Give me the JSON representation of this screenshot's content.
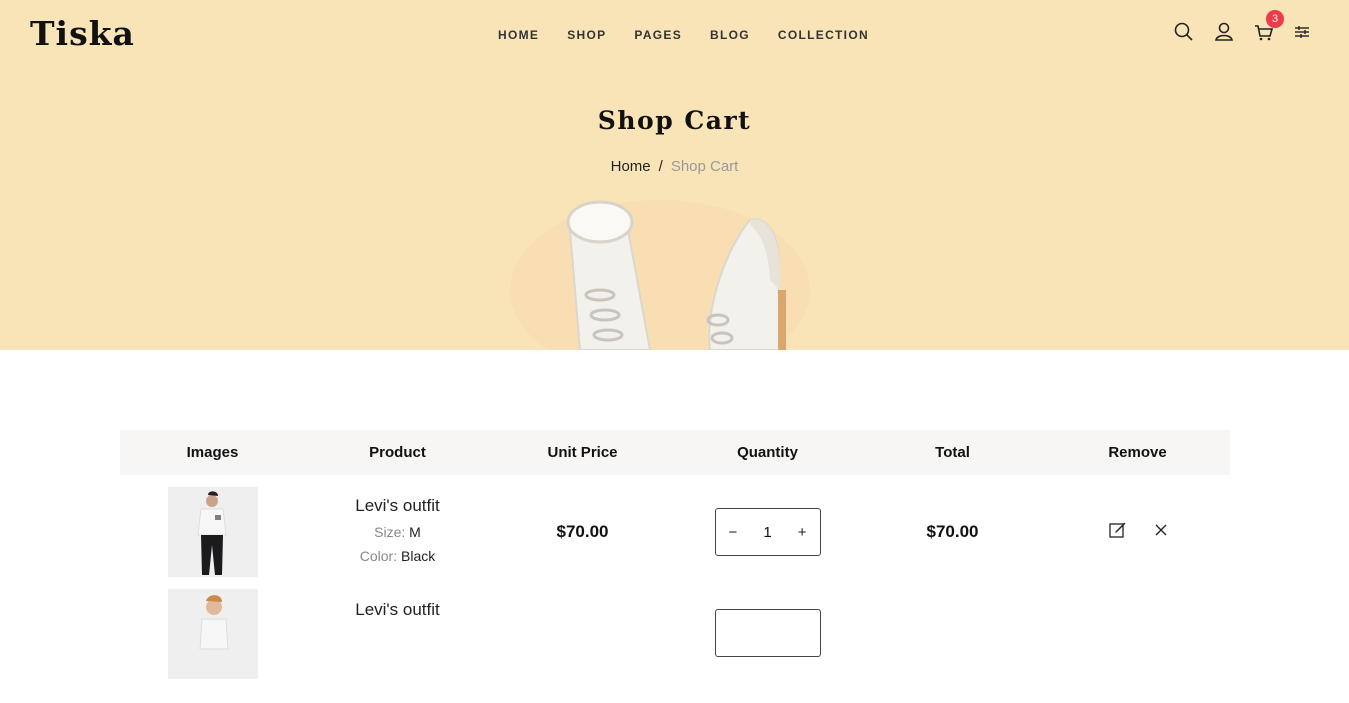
{
  "brand": "Tiska",
  "nav": [
    "HOME",
    "SHOP",
    "PAGES",
    "BLOG",
    "COLLECTION"
  ],
  "cart_count": "3",
  "hero": {
    "title": "Shop Cart",
    "breadcrumb_home": "Home",
    "breadcrumb_sep": "/",
    "breadcrumb_current": "Shop Cart"
  },
  "table": {
    "headers": [
      "Images",
      "Product",
      "Unit Price",
      "Quantity",
      "Total",
      "Remove"
    ],
    "rows": [
      {
        "name": "Levi's outfit",
        "size_label": "Size:",
        "size": "M",
        "color_label": "Color:",
        "color": "Black",
        "price": "$70.00",
        "qty": "1",
        "total": "$70.00",
        "minus": "−",
        "plus": "+"
      },
      {
        "name": "Levi's outfit"
      }
    ]
  },
  "colors": {
    "hero_bg": "#f9e4b8",
    "badge": "#ef3a49"
  }
}
